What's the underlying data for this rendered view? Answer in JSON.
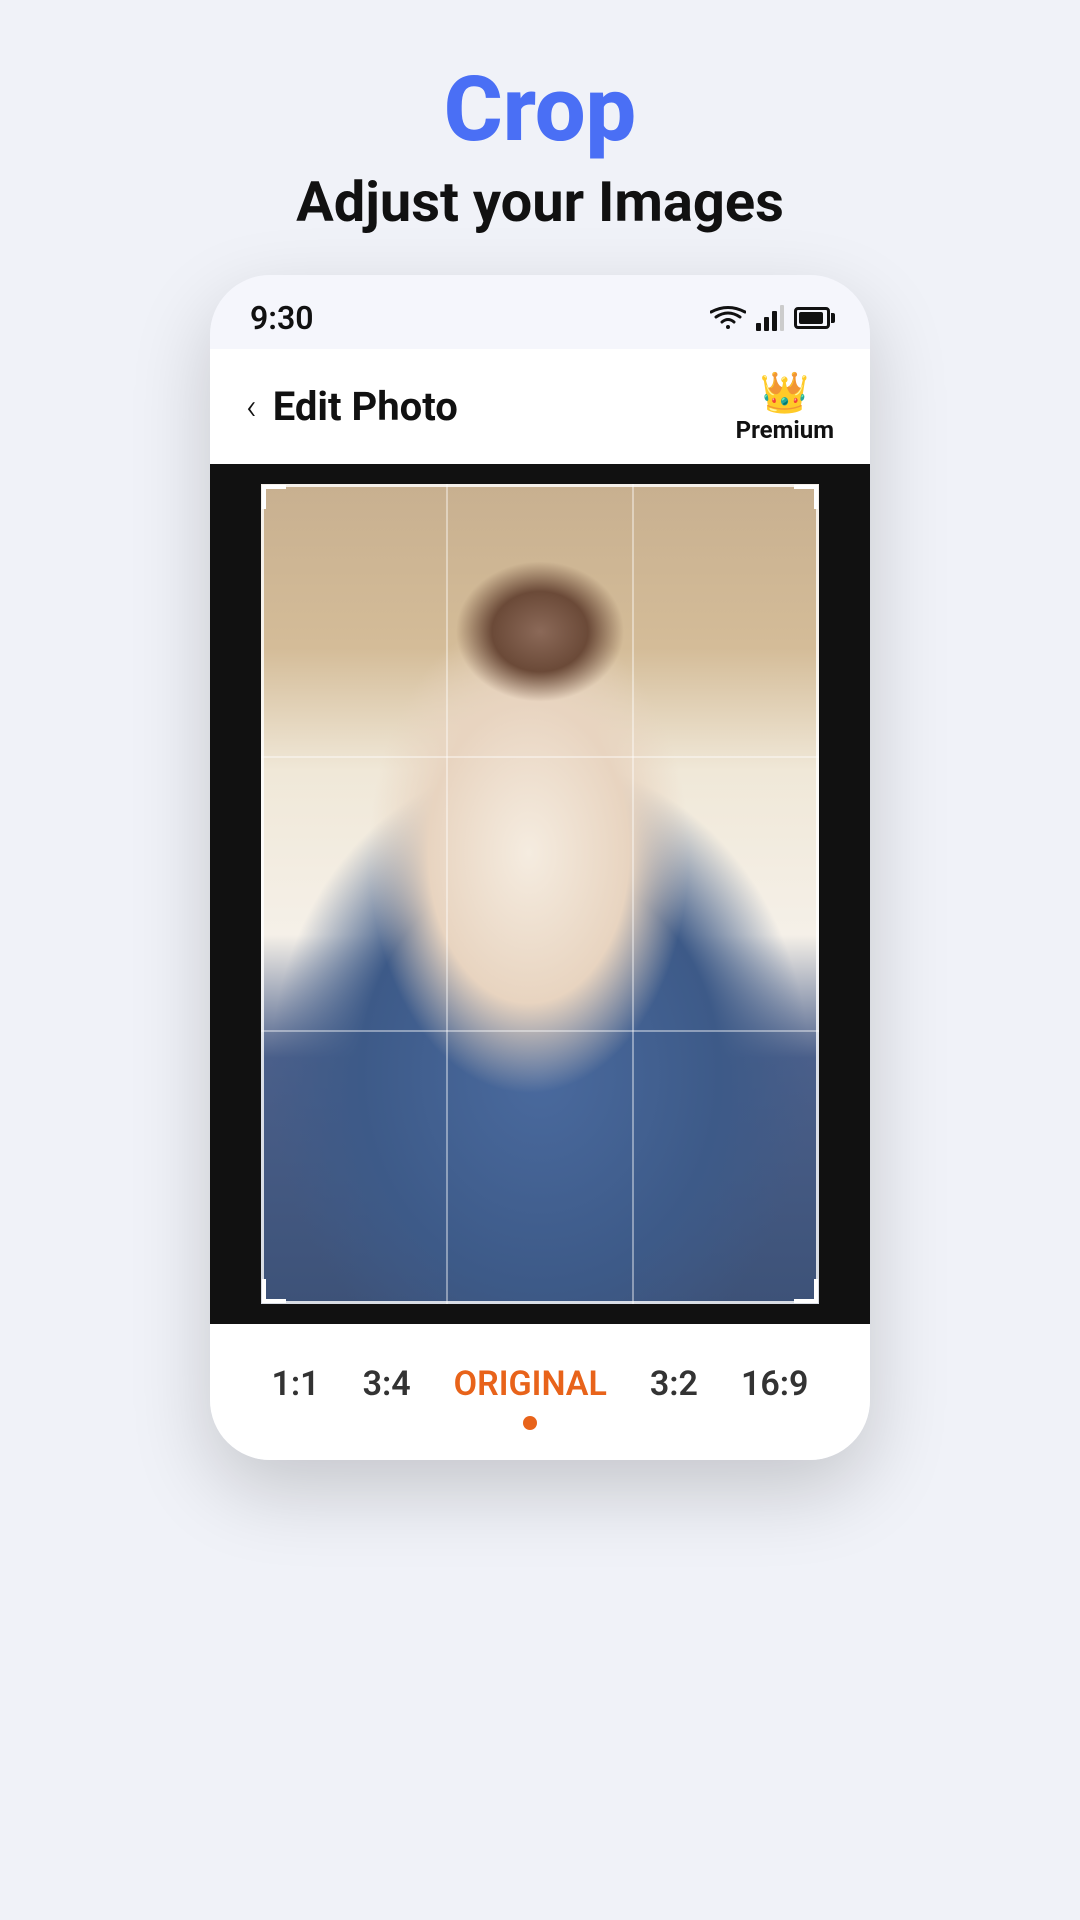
{
  "page": {
    "title": "Crop",
    "subtitle": "Adjust your Images"
  },
  "statusBar": {
    "time": "9:30"
  },
  "appHeader": {
    "title": "Edit Photo",
    "backLabel": "<",
    "premiumLabel": "Premium"
  },
  "ratioBar": {
    "options": [
      {
        "label": "1:1",
        "active": false
      },
      {
        "label": "3:4",
        "active": false
      },
      {
        "label": "ORIGINAL",
        "active": true
      },
      {
        "label": "3:2",
        "active": false
      },
      {
        "label": "16:9",
        "active": false
      }
    ]
  }
}
